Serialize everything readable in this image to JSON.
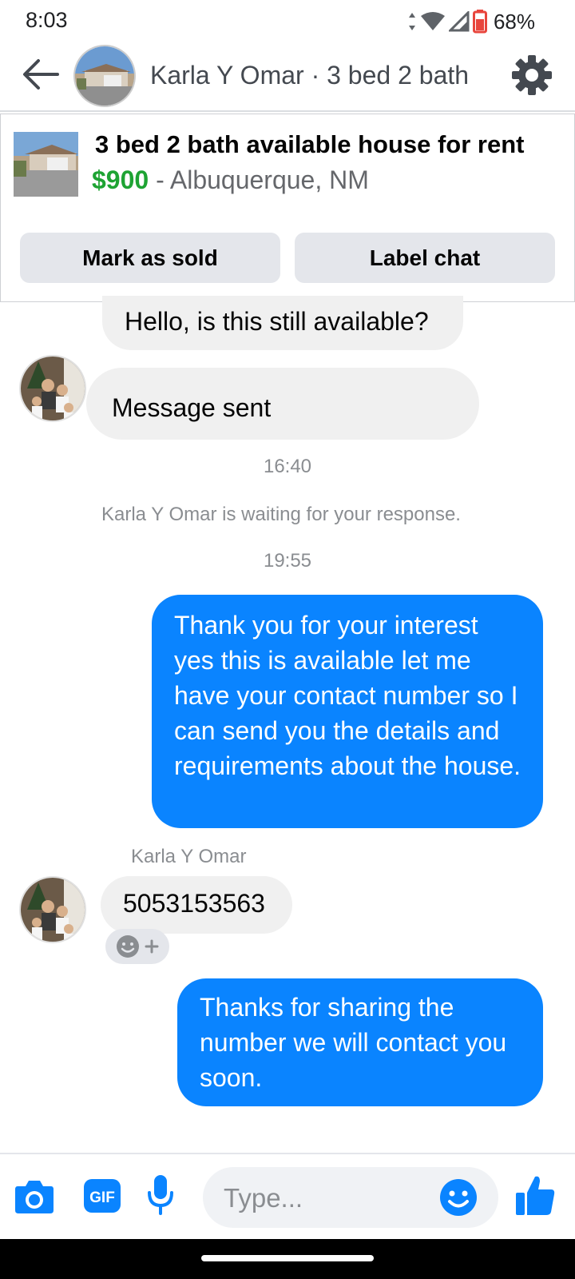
{
  "status_bar": {
    "time": "8:03",
    "battery": "68%",
    "icons": [
      "data-arrows-icon",
      "wifi-icon",
      "signal-icon",
      "battery-icon"
    ]
  },
  "header": {
    "title": "Karla Y Omar · 3 bed 2 bath",
    "icons": [
      "back-arrow-icon",
      "gear-icon"
    ]
  },
  "listing": {
    "title": "3 bed 2 bath available house for rent",
    "price": "$900",
    "separator": " - ",
    "location": "Albuquerque, NM",
    "buttons": {
      "mark_sold": "Mark as sold",
      "label_chat": "Label chat"
    }
  },
  "messages": {
    "m1": "Hello, is this still available?",
    "m2": "Message sent",
    "time1": "16:40",
    "waiting": "Karla Y Omar is waiting for your response.",
    "time2": "19:55",
    "m3": "Thank you for your interest yes this is available let me have your contact number so I can send you the details and requirements about the house.",
    "sender": "Karla Y Omar",
    "m4": "5053153563",
    "m5": "Thanks for sharing the number we will contact you soon."
  },
  "composer": {
    "placeholder": "Type...",
    "icons": [
      "camera-icon",
      "gif-icon",
      "microphone-icon",
      "emoji-icon",
      "thumbs-up-icon"
    ],
    "gif_label": "GIF"
  },
  "colors": {
    "accent": "#0a84ff",
    "price_green": "#1ea333",
    "incoming_bubble": "#f0f0f0",
    "button_gray": "#e4e6eb",
    "battery_red": "#e8453c"
  }
}
